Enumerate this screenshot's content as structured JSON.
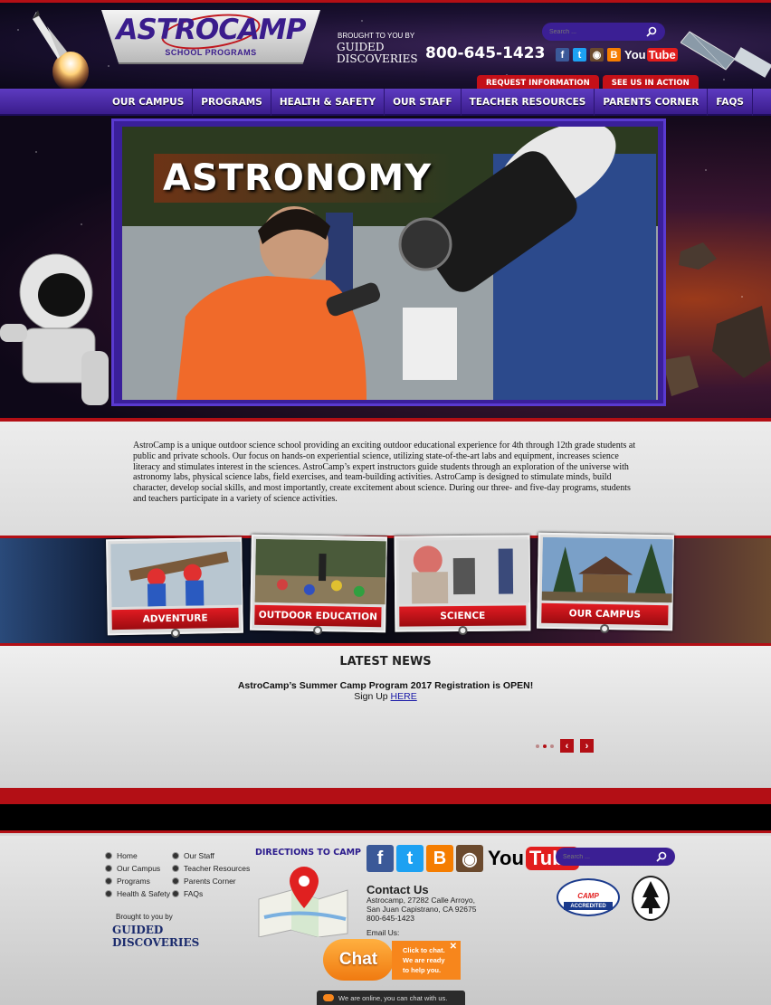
{
  "header": {
    "logo_text": "ASTROCAMP",
    "logo_sub": "SCHOOL PROGRAMS",
    "brought_to_you_by": "BROUGHT TO YOU BY",
    "sponsor_logo": "GUIDED DISCOVERIES",
    "phone": "800-645-1423",
    "search_placeholder": "Search ...",
    "social": [
      {
        "name": "facebook-icon",
        "glyph": "f",
        "color": "#3b5998"
      },
      {
        "name": "twitter-icon",
        "glyph": "t",
        "color": "#1da1f2"
      },
      {
        "name": "instagram-icon",
        "glyph": "◉",
        "color": "#6b4a2e"
      },
      {
        "name": "blogger-icon",
        "glyph": "B",
        "color": "#f57d00"
      }
    ],
    "youtube_you": "You",
    "youtube_tube": "Tube",
    "request_info": "REQUEST INFORMATION",
    "see_us": "SEE US IN ACTION"
  },
  "nav": {
    "items": [
      "OUR CAMPUS",
      "PROGRAMS",
      "HEALTH & SAFETY",
      "OUR STAFF",
      "TEACHER RESOURCES",
      "PARENTS CORNER",
      "FAQS"
    ]
  },
  "hero": {
    "title": "ASTRONOMY"
  },
  "intro": {
    "text": "AstroCamp is a unique outdoor science school providing an exciting outdoor educational experience for 4th through 12th grade students at public and private schools. Our focus on hands-on experiential science, utilizing state-of-the-art labs and equipment, increases science literacy and stimulates interest in the sciences. AstroCamp’s expert instructors guide students through an exploration of the universe with astronomy labs, physical science labs, field exercises, and team-building activities. AstroCamp is designed to stimulate minds, build character, develop social skills, and most importantly, create excitement about science. During our three- and five-day programs, students and teachers participate in a variety of science activities."
  },
  "features": {
    "cards": [
      "ADVENTURE",
      "OUTDOOR EDUCATION",
      "SCIENCE",
      "OUR CAMPUS"
    ]
  },
  "news": {
    "title": "LATEST NEWS",
    "headline": "AstroCamp’s Summer Camp Program 2017 Registration is OPEN!",
    "sign_up": "Sign Up",
    "link": "HERE",
    "prev": "‹",
    "next": "›"
  },
  "footer": {
    "links_col1": [
      "Home",
      "Our Campus",
      "Programs",
      "Health & Safety"
    ],
    "links_col2": [
      "Our Staff",
      "Teacher Resources",
      "Parents Corner",
      "FAQs"
    ],
    "brought_to_you_by": "Brought to you by",
    "sponsor_logo": "GUIDED DISCOVERIES",
    "directions": "DIRECTIONS TO CAMP",
    "contact_heading": "Contact Us",
    "address_line1": "Astrocamp, 27282 Calle Arroyo,",
    "address_line2": "San Juan Capistrano, CA 92675",
    "phone": "800-645-1423",
    "email_label": "Email Us:",
    "search_placeholder": "Search ...",
    "accredited_logo": "CAMP",
    "accredited_badge": "ACCREDITED",
    "seal": "Western Association of Independent Camps"
  },
  "chat": {
    "button": "Chat",
    "popup_line1": "Click to chat.",
    "popup_line2": "We are ready",
    "popup_line3": "to help you.",
    "close": "✕",
    "online": "We are online, you can chat with us."
  }
}
